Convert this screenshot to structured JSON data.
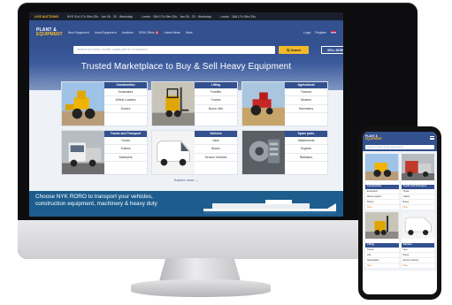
{
  "ticker": {
    "live_label": "LIVE AUCTIONS",
    "items": [
      "NYE 01d 17h 09m 33s · Jan 06 - 20 · Weekday!",
      "Leeds · 18d 17h 09m 33s · Jan 06 - 20 · Weekday!",
      "Leeds · 18d 17h 09m 33s"
    ]
  },
  "header": {
    "logo_line1": "PLANT &",
    "logo_line2": "EQUIPMENT",
    "nav": [
      "New Equipment",
      "Used Equipment",
      "Auctions",
      "OEM Offers",
      "Latest News",
      "More"
    ],
    "nav_badge": "8",
    "login": "Login",
    "register": "Register",
    "search_placeholder": "Search by brand, model, spare part ID or keyword",
    "search_button": "Search",
    "sell_button": "SELL NOW"
  },
  "hero": {
    "title": "Trusted Marketplace to Buy & Sell Heavy Equipment"
  },
  "categories": [
    {
      "title": "Construction",
      "subs": [
        "Excavators",
        "Wheel Loaders",
        "Dozers"
      ]
    },
    {
      "title": "Lifting",
      "subs": [
        "Forklifts",
        "Cranes",
        "Boom Lifts"
      ]
    },
    {
      "title": "Agricultural",
      "subs": [
        "Tractors",
        "Mowers",
        "Harvesters"
      ]
    },
    {
      "title": "Trucks and Transport",
      "subs": [
        "Trucks",
        "Trailers",
        "Sweepers"
      ]
    },
    {
      "title": "Vehicles",
      "subs": [
        "Vans",
        "Buses",
        "Service Vehicles"
      ]
    },
    {
      "title": "Spare parts",
      "subs": [
        "Attachments",
        "Engines",
        "Radiators"
      ]
    }
  ],
  "explore_more": "Explore more →",
  "banner": {
    "line1": "Choose NYK RORO to transport your vehicles,",
    "line2": "construction equipment, machinery & heavy duty"
  },
  "phone": {
    "logo_line1": "PLANT &",
    "logo_line2": "EQUIPMENT",
    "search_placeholder": "Search by brand, model, spare part ID",
    "cards": [
      {
        "title": "Construction",
        "subs": [
          "Excavators",
          "Wheel Loaders",
          "Dozers"
        ],
        "more": "More"
      },
      {
        "title": "Trucks and Transport",
        "subs": [
          "Trucks",
          "Trailers",
          "Buses"
        ],
        "more": "More"
      },
      {
        "title": "Lifting",
        "subs": [
          "Cranes",
          "Lifts",
          "Telehandlers"
        ],
        "more": "More"
      },
      {
        "title": "Vehicles",
        "subs": [
          "Vans",
          "Buses",
          "Service Vehicles"
        ],
        "more": "More"
      }
    ]
  },
  "colors": {
    "brand_blue": "#33508f",
    "accent_yellow": "#f2b92a",
    "banner_blue": "#1d5d8e"
  }
}
